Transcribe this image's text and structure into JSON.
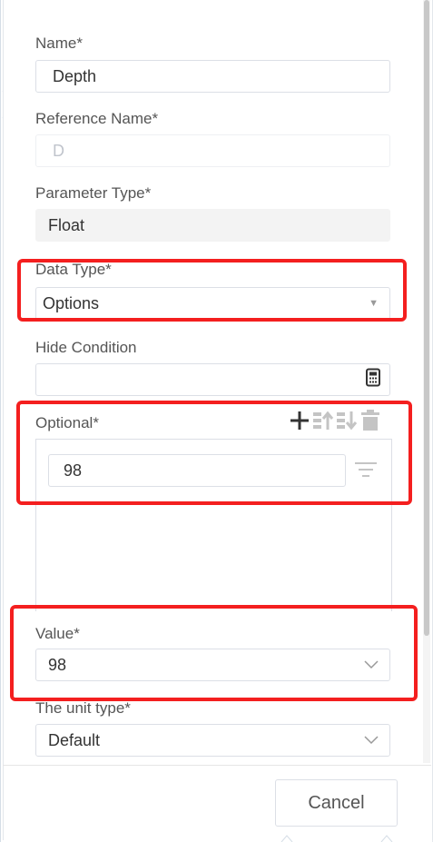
{
  "form": {
    "name": {
      "label": "Name*",
      "value": "Depth"
    },
    "reference_name": {
      "label": "Reference Name*",
      "placeholder": "D"
    },
    "parameter_type": {
      "label": "Parameter Type*",
      "value": "Float"
    },
    "data_type": {
      "label": "Data Type*",
      "value": "Options",
      "caret_icon": "caret-down-icon"
    },
    "hide_condition": {
      "label": "Hide Condition",
      "value": "",
      "icon": "calculator-icon"
    },
    "optional": {
      "label": "Optional*",
      "toolbar": [
        "add-icon",
        "move-up-icon",
        "move-down-icon",
        "delete-icon"
      ],
      "items": [
        {
          "value": "98"
        }
      ],
      "filter_icon": "filter-icon"
    },
    "value": {
      "label": "Value*",
      "value": "98",
      "icon": "chevron-down-icon"
    },
    "unit_type": {
      "label": "The unit type*",
      "value": "Default",
      "icon": "chevron-down-icon"
    }
  },
  "footer": {
    "cancel_label": "Cancel"
  },
  "colors": {
    "highlight": "#f41f1f",
    "border": "#dcdfe6",
    "label_text": "#555555",
    "disabled_text": "#c0c4cc",
    "readonly_bg": "#f3f3f3"
  }
}
